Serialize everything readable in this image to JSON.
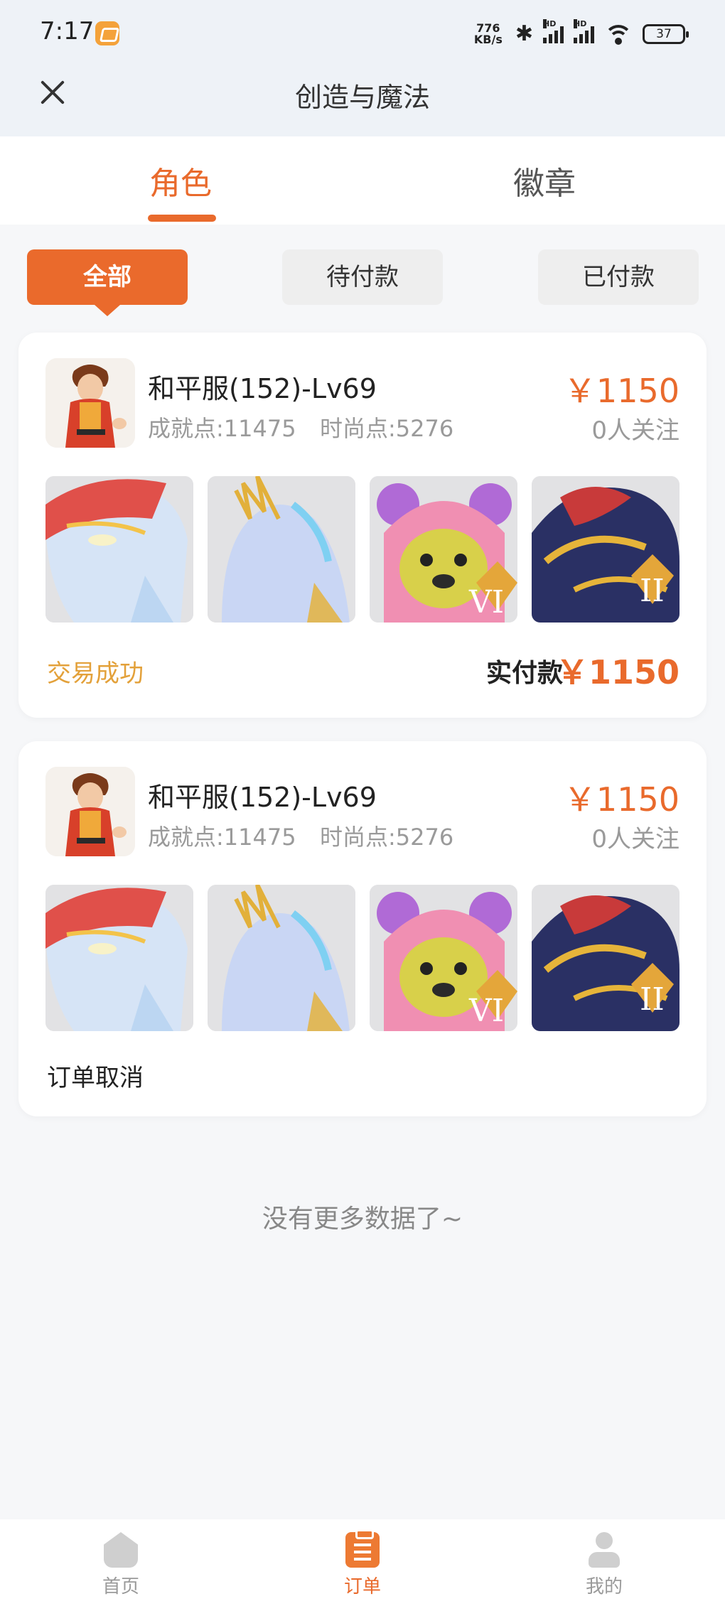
{
  "status_bar": {
    "time": "7:17",
    "net_speed_value": "776",
    "net_speed_unit": "KB/s",
    "battery": "37",
    "signal_label": "HD"
  },
  "header": {
    "title": "创造与魔法",
    "close_icon": "close-icon"
  },
  "tabs": [
    {
      "label": "角色",
      "active": true
    },
    {
      "label": "徽章",
      "active": false
    }
  ],
  "filters": [
    {
      "label": "全部",
      "active": true
    },
    {
      "label": "待付款",
      "active": false
    },
    {
      "label": "已付款",
      "active": false
    }
  ],
  "orders": [
    {
      "name": "和平服(152)-Lv69",
      "achievement": "成就点:11475",
      "fashion": "时尚点:5276",
      "price": "￥1150",
      "followers": "0人关注",
      "status": "交易成功",
      "paid_label": "实付款",
      "paid_amount": "￥1150",
      "thumbnails": [
        "mount-fish",
        "mount-horse",
        "pink-bear-VI",
        "dragon-II"
      ]
    },
    {
      "name": "和平服(152)-Lv69",
      "achievement": "成就点:11475",
      "fashion": "时尚点:5276",
      "price": "￥1150",
      "followers": "0人关注",
      "status": "订单取消",
      "thumbnails": [
        "mount-fish",
        "mount-horse",
        "pink-bear-VI",
        "dragon-II"
      ]
    }
  ],
  "thumb_badges": {
    "bear": "VI",
    "dragon": "II"
  },
  "footer_text": "没有更多数据了~",
  "bottom_nav": [
    {
      "label": "首页",
      "icon": "home-icon",
      "active": false
    },
    {
      "label": "订单",
      "icon": "order-icon",
      "active": true
    },
    {
      "label": "我的",
      "icon": "person-icon",
      "active": false
    }
  ],
  "colors": {
    "accent": "#e96a2c",
    "success": "#e3a13a",
    "inactive_nav": "#9a9a9a"
  }
}
